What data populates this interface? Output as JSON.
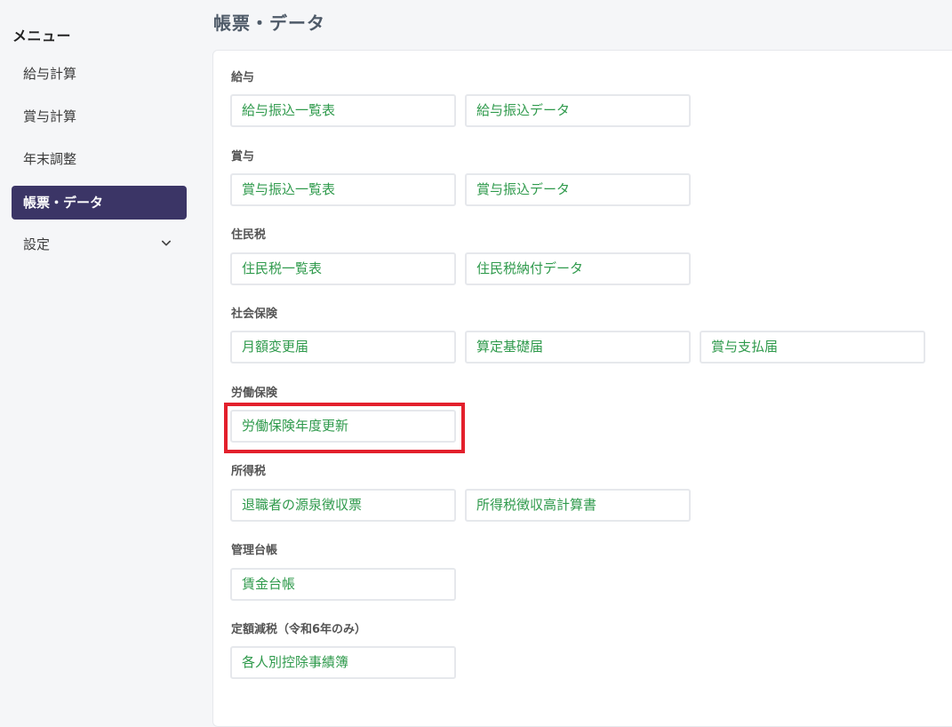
{
  "sidebar": {
    "title": "メニュー",
    "items": [
      {
        "label": "給与計算"
      },
      {
        "label": "賞与計算"
      },
      {
        "label": "年末調整"
      },
      {
        "label": "帳票・データ"
      },
      {
        "label": "設定"
      }
    ]
  },
  "main": {
    "title": "帳票・データ",
    "sections": [
      {
        "label": "給与",
        "buttons": [
          "給与振込一覧表",
          "給与振込データ"
        ]
      },
      {
        "label": "賞与",
        "buttons": [
          "賞与振込一覧表",
          "賞与振込データ"
        ]
      },
      {
        "label": "住民税",
        "buttons": [
          "住民税一覧表",
          "住民税納付データ"
        ]
      },
      {
        "label": "社会保険",
        "buttons": [
          "月額変更届",
          "算定基礎届",
          "賞与支払届"
        ]
      },
      {
        "label": "労働保険",
        "buttons": [
          "労働保険年度更新"
        ]
      },
      {
        "label": "所得税",
        "buttons": [
          "退職者の源泉徴収票",
          "所得税徴収高計算書"
        ]
      },
      {
        "label": "管理台帳",
        "buttons": [
          "賃金台帳"
        ]
      },
      {
        "label": "定額減税（令和6年のみ）",
        "buttons": [
          "各人別控除事績簿"
        ]
      }
    ]
  },
  "colors": {
    "active_nav_bg": "#3b3566",
    "link_green": "#2f9a4c",
    "highlight_red": "#e3202c"
  },
  "icons": {
    "settings_expand": "chevron-down-icon"
  }
}
